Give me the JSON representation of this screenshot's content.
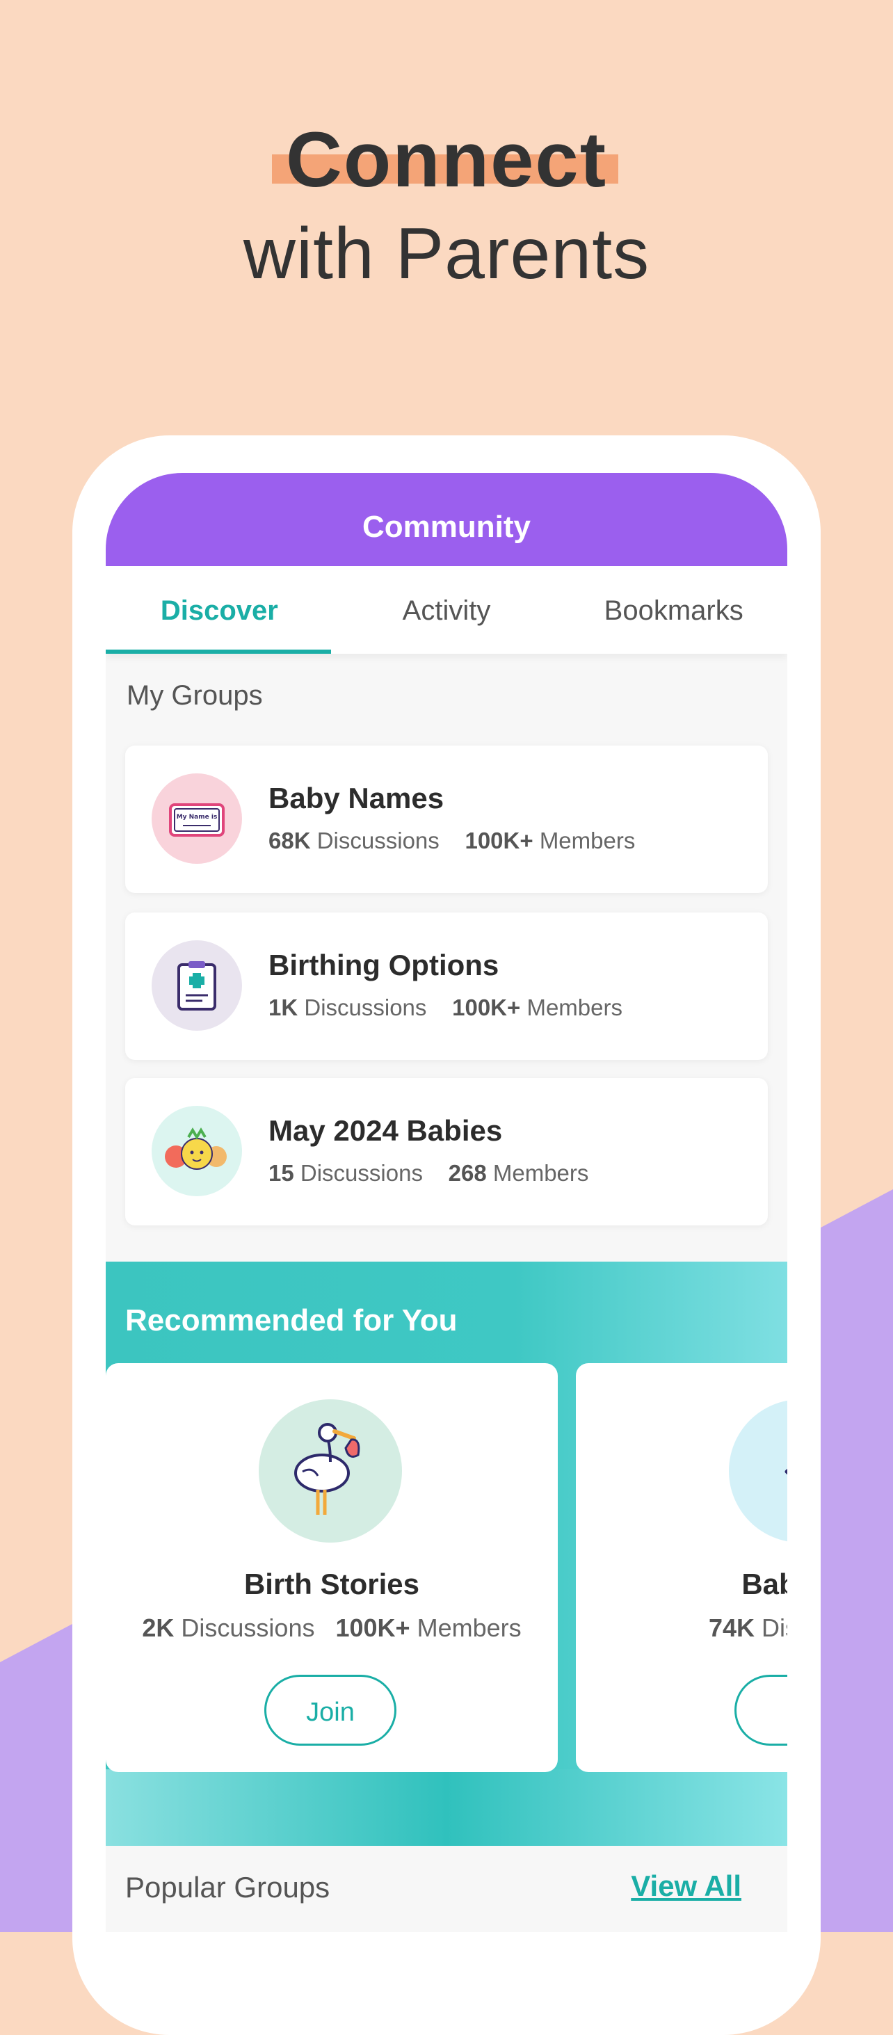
{
  "hero": {
    "title": "Connect",
    "subtitle": "with Parents"
  },
  "header": {
    "title": "Community"
  },
  "tabs": [
    {
      "label": "Discover",
      "active": true
    },
    {
      "label": "Activity",
      "active": false
    },
    {
      "label": "Bookmarks",
      "active": false
    }
  ],
  "my_groups": {
    "title": "My Groups",
    "items": [
      {
        "name": "Baby Names",
        "discussions_count": "68K",
        "discussions_label": "Discussions",
        "members_count": "100K+",
        "members_label": "Members",
        "icon": "name-tag-icon",
        "icon_bg": "#f9d3db"
      },
      {
        "name": "Birthing Options",
        "discussions_count": "1K",
        "discussions_label": "Discussions",
        "members_count": "100K+",
        "members_label": "Members",
        "icon": "clipboard-medical-icon",
        "icon_bg": "#e9e4ef"
      },
      {
        "name": "May 2024 Babies",
        "discussions_count": "15",
        "discussions_label": "Discussions",
        "members_count": "268",
        "members_label": "Members",
        "icon": "fruit-babies-icon",
        "icon_bg": "#dcf5f0"
      }
    ]
  },
  "recommended": {
    "title": "Recommended for You",
    "items": [
      {
        "name": "Birth Stories",
        "discussions_count": "2K",
        "discussions_label": "Discussions",
        "members_count": "100K+",
        "members_label": "Members",
        "join_label": "Join",
        "icon": "stork-icon",
        "icon_bg": "#d4ede3"
      },
      {
        "name": "Baby's F",
        "discussions_count": "74K",
        "discussions_label": "Discussions",
        "members_count": "",
        "members_label": "",
        "join_label": "J",
        "icon": "chevron-icon",
        "icon_bg": "#d4f1f8"
      }
    ]
  },
  "popular": {
    "title": "Popular Groups",
    "view_all_label": "View All"
  },
  "colors": {
    "accent": "#1aaea6",
    "header": "#9b5fee",
    "background": "#fbd9c1",
    "purple_shape": "#c3a5f0"
  }
}
